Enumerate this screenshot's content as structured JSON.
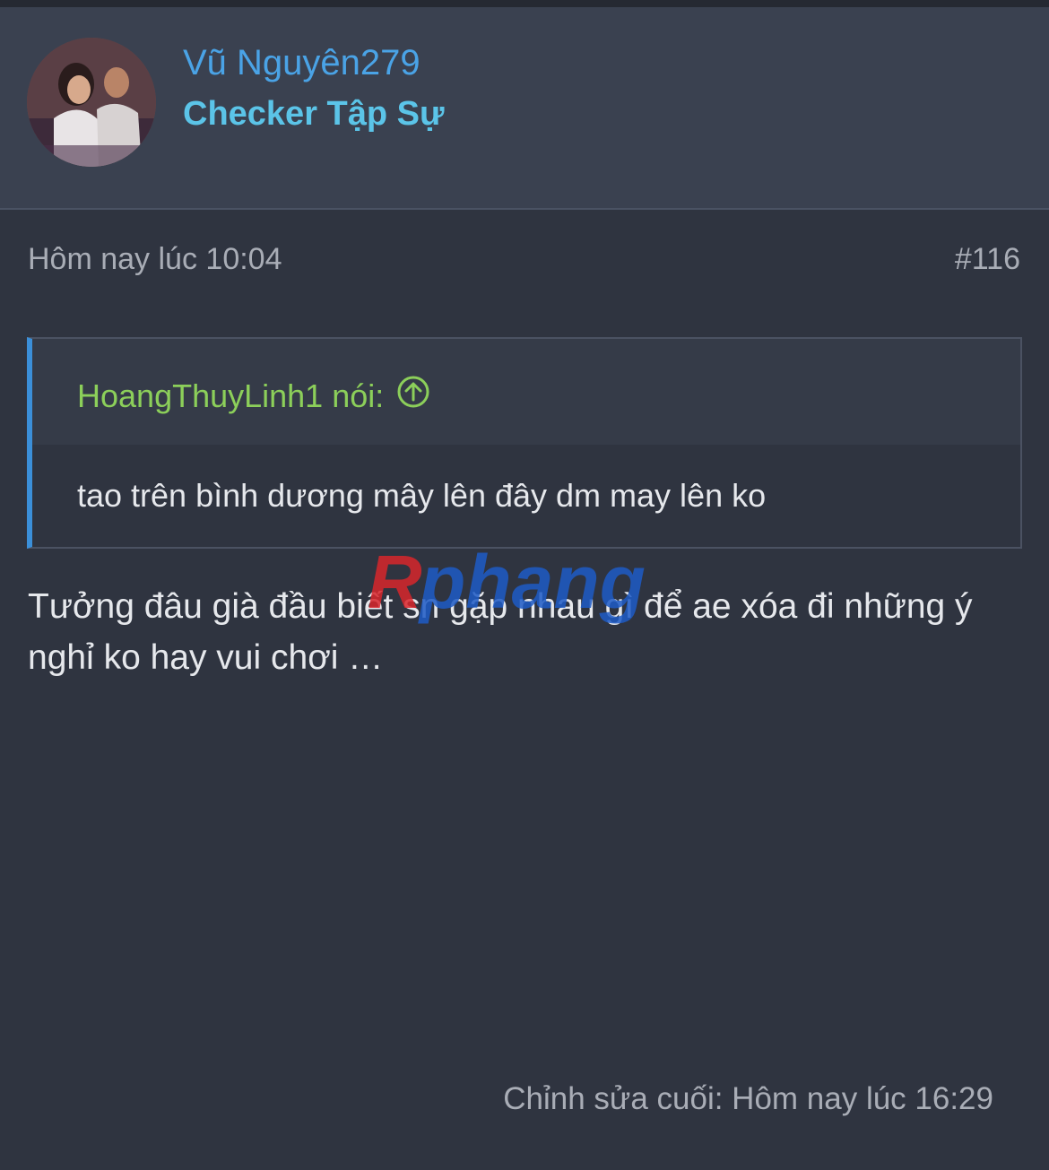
{
  "header": {
    "username": "Vũ Nguyên279",
    "user_title": "Checker Tập Sự"
  },
  "post": {
    "time": "Hôm nay lúc 10:04",
    "number": "#116",
    "quote": {
      "author": "HoangThuyLinh1 nói:",
      "text": "tao trên bình dương mây lên đây dm may lên ko"
    },
    "body": "Tưởng đâu già đầu biết sn gặp nhau gì để ae xóa đi những ý nghỉ ko hay vui chơi …",
    "edited": "Chỉnh sửa cuối: Hôm nay lúc 16:29"
  },
  "watermark": "Rphang",
  "colors": {
    "background": "#2f3440",
    "header": "#3a4150",
    "username": "#4aa3e6",
    "quote_author": "#8ccf5a",
    "quote_border": "#3b8fd9"
  }
}
